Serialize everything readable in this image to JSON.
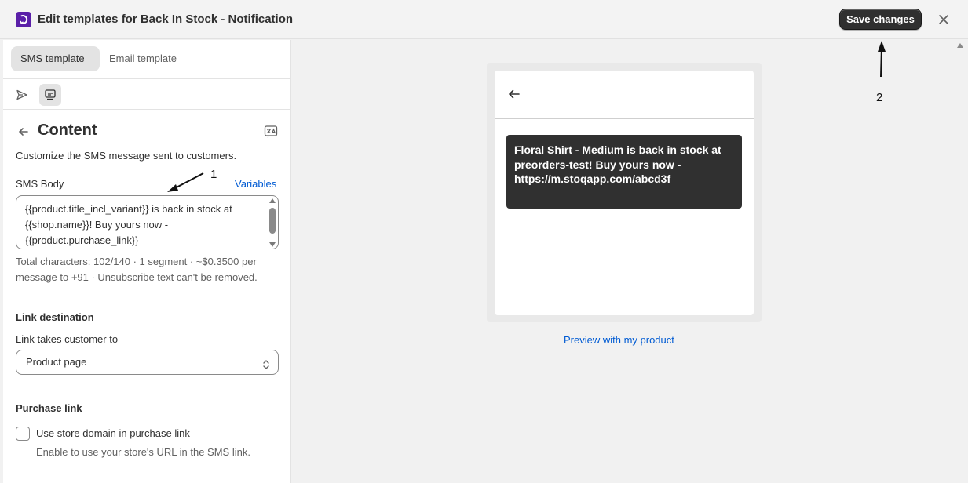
{
  "header": {
    "title": "Edit templates for Back In Stock - Notification",
    "save_label": "Save changes",
    "app_icon": "app-logo-icon",
    "close_icon": "close-icon"
  },
  "tabs": [
    {
      "label": "SMS template",
      "active": true
    },
    {
      "label": "Email template",
      "active": false
    }
  ],
  "toolbar_icons": [
    "send-icon",
    "sms-preview-icon"
  ],
  "content": {
    "heading": "Content",
    "description": "Customize the SMS message sent to customers.",
    "sms_body_label": "SMS Body",
    "variables_label": "Variables",
    "sms_body_lines": [
      "{{product.title_incl_variant}} is back in stock at",
      "{{shop.name}}! Buy yours now -",
      "{{product.purchase_link}}"
    ],
    "char_info_lines": [
      "Total characters: 102/140 · 1 segment · ~$0.3500 per",
      "message to +91 · Unsubscribe text can't be removed."
    ]
  },
  "link_destination": {
    "heading": "Link destination",
    "label": "Link takes customer to",
    "selected": "Product page"
  },
  "purchase_link": {
    "heading": "Purchase link",
    "checkbox_label": "Use store domain in purchase link",
    "checked": false,
    "help": "Enable to use your store's URL in the SMS link."
  },
  "preview": {
    "message_lines": [
      "Floral Shirt - Medium is back in stock at",
      "preorders-test! Buy yours now -",
      "https://m.stoqapp.com/abcd3f"
    ],
    "preview_link": "Preview with my product"
  },
  "annotations": {
    "one": "1",
    "two": "2"
  },
  "colors": {
    "accent_link": "#005bd3",
    "primary_button": "#303030",
    "app_logo": "#5a1fa8"
  }
}
